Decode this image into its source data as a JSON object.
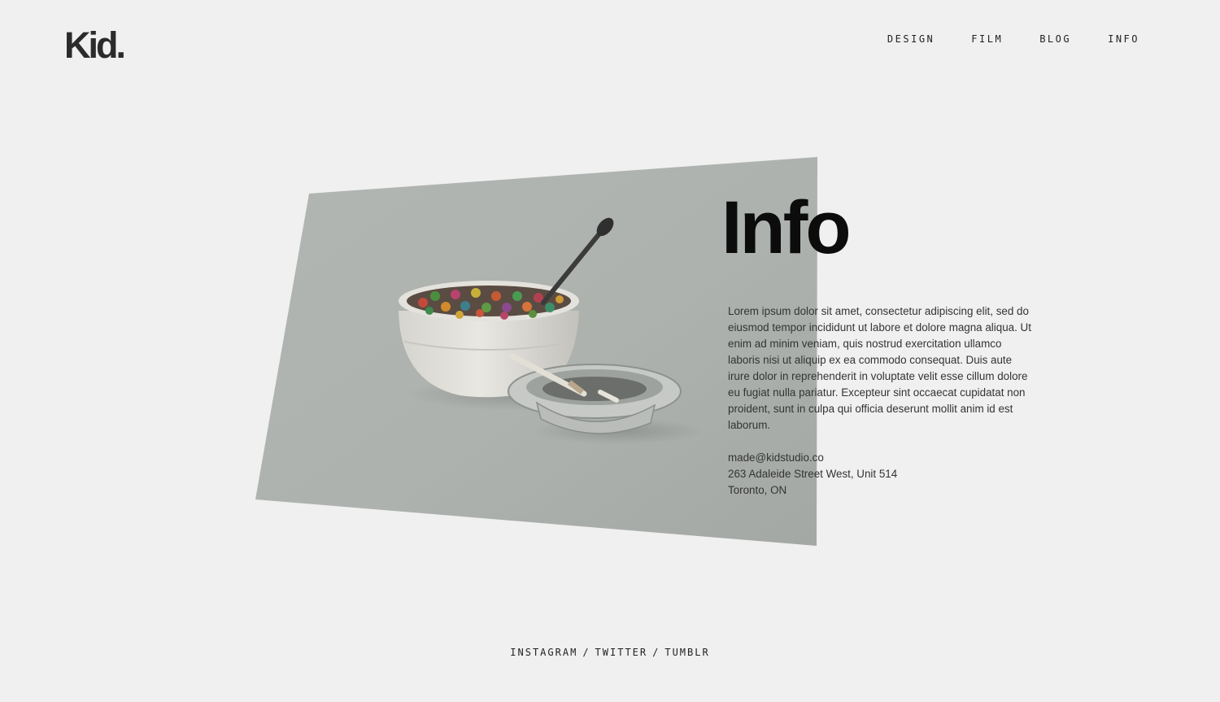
{
  "brand": {
    "logo_text": "Kid."
  },
  "nav": {
    "items": [
      {
        "label": "DESIGN"
      },
      {
        "label": "FILM"
      },
      {
        "label": "BLOG"
      },
      {
        "label": "INFO"
      }
    ]
  },
  "info": {
    "title": "Info",
    "body": "Lorem ipsum dolor sit amet, consectetur adipiscing elit, sed do eiusmod tempor incididunt ut labore et dolore magna aliqua. Ut enim ad minim veniam, quis nostrud exercitation ullamco laboris nisi ut aliquip ex ea commodo consequat. Duis aute irure dolor in reprehenderit in voluptate velit esse cillum dolore eu fugiat nulla pariatur. Excepteur sint occaecat cupidatat non proident, sunt in culpa qui officia deserunt mollit anim id est laborum.",
    "email": "made@kidstudio.co",
    "address_line1": "263 Adaleide Street West, Unit 514",
    "address_line2": "Toronto, ON"
  },
  "social": {
    "links": [
      {
        "label": "INSTAGRAM"
      },
      {
        "label": "TWITTER"
      },
      {
        "label": "TUMBLR"
      }
    ],
    "separator": "/"
  },
  "colors": {
    "background": "#f0f0f0",
    "photo_backdrop": "#a9ada9",
    "text": "#222222"
  },
  "icons": {
    "photo": "cereal-bowl-ashtray-photo"
  }
}
